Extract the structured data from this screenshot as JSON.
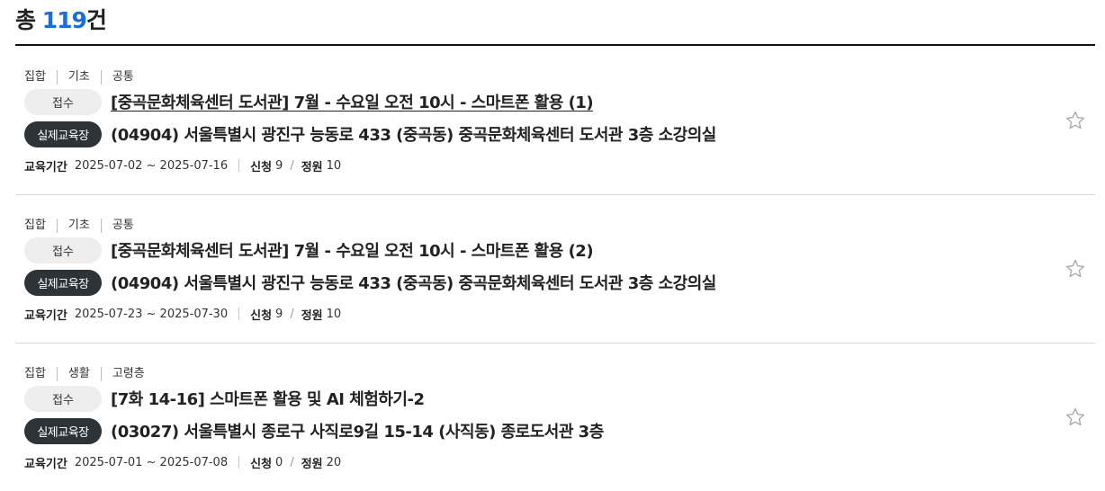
{
  "summary": {
    "prefix": "총 ",
    "count": "119",
    "suffix": "건"
  },
  "labels": {
    "period": "교육기간",
    "applied": "신청",
    "capacity": "정원",
    "place_badge": "실제교육장"
  },
  "icons": {
    "favorite": "star-outline-icon"
  },
  "colors": {
    "accent": "#1a6fd0",
    "badge_dark": "#2e3338",
    "badge_light": "#eeeeee"
  },
  "courses": [
    {
      "tags": [
        "집합",
        "기초",
        "공통"
      ],
      "status": "접수",
      "title": "[중곡문화체육센터 도서관] 7월 - 수요일 오전 10시 - 스마트폰 활용 (1)",
      "address": "(04904) 서울특별시 광진구 능동로 433 (중곡동) 중곡문화체육센터 도서관 3층 소강의실",
      "period": "2025-07-02 ~ 2025-07-16",
      "applied": "9",
      "capacity": "10"
    },
    {
      "tags": [
        "집합",
        "기초",
        "공통"
      ],
      "status": "접수",
      "title": "[중곡문화체육센터 도서관] 7월 - 수요일 오전 10시 - 스마트폰 활용 (2)",
      "address": "(04904) 서울특별시 광진구 능동로 433 (중곡동) 중곡문화체육센터 도서관 3층 소강의실",
      "period": "2025-07-23 ~ 2025-07-30",
      "applied": "9",
      "capacity": "10"
    },
    {
      "tags": [
        "집합",
        "생활",
        "고령층"
      ],
      "status": "접수",
      "title": "[7화 14-16] 스마트폰 활용 및 AI 체험하기-2",
      "address": "(03027) 서울특별시 종로구 사직로9길 15-14 (사직동) 종로도서관 3층",
      "period": "2025-07-01 ~ 2025-07-08",
      "applied": "0",
      "capacity": "20"
    }
  ]
}
